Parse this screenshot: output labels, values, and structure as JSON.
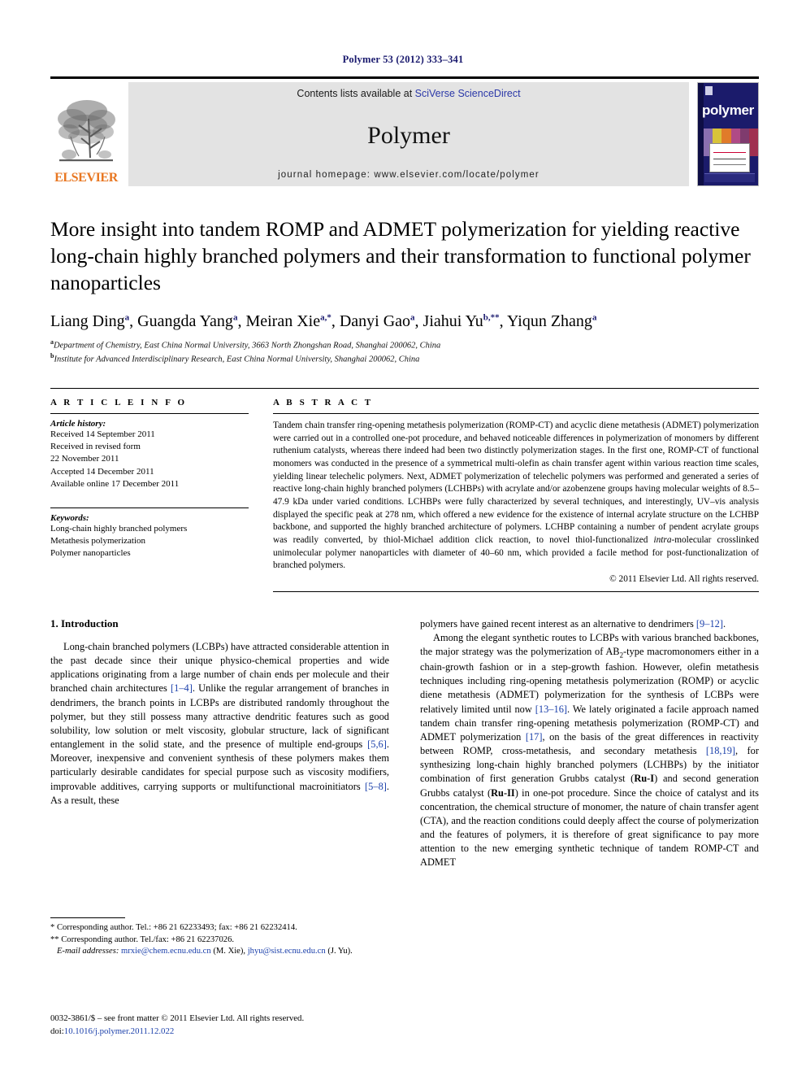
{
  "running_head": "Polymer 53 (2012) 333–341",
  "masthead": {
    "publisher": "ELSEVIER",
    "contents_prefix": "Contents lists available at ",
    "contents_link": "SciVerse ScienceDirect",
    "journal_title": "Polymer",
    "homepage": "journal homepage: www.elsevier.com/locate/polymer",
    "cover_word": "polymer"
  },
  "article": {
    "title": "More insight into tandem ROMP and ADMET polymerization for yielding reactive long-chain highly branched polymers and their transformation to functional polymer nanoparticles",
    "authors": [
      {
        "name": "Liang Ding",
        "sup": "a",
        "sep": ", "
      },
      {
        "name": "Guangda Yang",
        "sup": "a",
        "sep": ", "
      },
      {
        "name": "Meiran Xie",
        "sup": "a,*",
        "sep": ", "
      },
      {
        "name": "Danyi Gao",
        "sup": "a",
        "sep": ", "
      },
      {
        "name": "Jiahui Yu",
        "sup": "b,**",
        "sep": ", "
      },
      {
        "name": "Yiqun Zhang",
        "sup": "a",
        "sep": ""
      }
    ],
    "affiliations": [
      {
        "sup": "a",
        "text": "Department of Chemistry, East China Normal University, 3663 North Zhongshan Road, Shanghai 200062, China"
      },
      {
        "sup": "b",
        "text": "Institute for Advanced Interdisciplinary Research, East China Normal University, Shanghai 200062, China"
      }
    ]
  },
  "info": {
    "label": "A R T I C L E   I N F O",
    "history_heading": "Article history:",
    "history": [
      "Received 14 September 2011",
      "Received in revised form",
      "22 November 2011",
      "Accepted 14 December 2011",
      "Available online 17 December 2011"
    ],
    "keywords_heading": "Keywords:",
    "keywords": [
      "Long-chain highly branched polymers",
      "Metathesis polymerization",
      "Polymer nanoparticles"
    ]
  },
  "abstract": {
    "label": "A B S T R A C T",
    "part1": "Tandem chain transfer ring-opening metathesis polymerization (ROMP-CT) and acyclic diene metathesis (ADMET) polymerization were carried out in a controlled one-pot procedure, and behaved noticeable differences in polymerization of monomers by different ruthenium catalysts, whereas there indeed had been two distinctly polymerization stages. In the first one, ROMP-CT of functional monomers was conducted in the presence of a symmetrical multi-olefin as chain transfer agent within various reaction time scales, yielding linear telechelic polymers. Next, ADMET polymerization of telechelic polymers was performed and generated a series of reactive long-chain highly branched polymers (LCHBPs) with acrylate and/or azobenzene groups having molecular weights of 8.5–47.9 kDa under varied conditions. LCHBPs were fully characterized by several techniques, and interestingly, UV–vis analysis displayed the specific peak at 278 nm, which offered a new evidence for the existence of internal acrylate structure on the LCHBP backbone, and supported the highly branched architecture of polymers. LCHBP containing a number of pendent acrylate groups was readily converted, by thiol-Michael addition click reaction, to novel thiol-functionalized ",
    "italic": "intra",
    "part2": "-molecular crosslinked unimolecular polymer nanoparticles with diameter of 40–60 nm, which provided a facile method for post-functionalization of branched polymers.",
    "copyright": "© 2011 Elsevier Ltd. All rights reserved."
  },
  "section": {
    "number_title": "1. Introduction"
  },
  "body": {
    "left_p1_a": "Long-chain branched polymers (LCBPs) have attracted considerable attention in the past decade since their unique physico-chemical properties and wide applications originating from a large number of chain ends per molecule and their branched chain architectures ",
    "left_ref1": "[1–4]",
    "left_p1_b": ". Unlike the regular arrangement of branches in dendrimers, the branch points in LCBPs are distributed randomly throughout the polymer, but they still possess many attractive dendritic features such as good solubility, low solution or melt viscosity, globular structure, lack of significant entanglement in the solid state, and the presence of multiple end-groups ",
    "left_ref2": "[5,6]",
    "left_p1_c": ". Moreover, inexpensive and convenient synthesis of these polymers makes them particularly desirable candidates for special purpose such as viscosity modifiers, improvable additives, carrying supports or multifunctional macroinitiators ",
    "left_ref3": "[5–8]",
    "left_p1_d": ". As a result, these",
    "right_p1_a": "polymers have gained recent interest as an alternative to dendrimers ",
    "right_ref1": "[9–12]",
    "right_p1_b": ".",
    "right_p2_a": "Among the elegant synthetic routes to LCBPs with various branched backbones, the major strategy was the polymerization of AB",
    "right_sub1": "2",
    "right_p2_b": "-type macromonomers either in a chain-growth fashion or in a step-growth fashion. However, olefin metathesis techniques including ring-opening metathesis polymerization (ROMP) or acyclic diene metathesis (ADMET) polymerization for the synthesis of LCBPs were relatively limited until now ",
    "right_ref2": "[13–16]",
    "right_p2_c": ". We lately originated a facile approach named tandem chain transfer ring-opening metathesis polymerization (ROMP-CT) and ADMET polymerization ",
    "right_ref3": "[17]",
    "right_p2_d": ", on the basis of the great differences in reactivity between ROMP, cross-metathesis, and secondary metathesis ",
    "right_ref4": "[18,19]",
    "right_p2_e": ", for synthesizing long-chain highly branched polymers (LCHBPs) by the initiator combination of first generation Grubbs catalyst (",
    "right_bold1": "Ru-I",
    "right_p2_f": ") and second generation Grubbs catalyst (",
    "right_bold2": "Ru-II",
    "right_p2_g": ") in one-pot procedure. Since the choice of catalyst and its concentration, the chemical structure of monomer, the nature of chain transfer agent (CTA), and the reaction conditions could deeply affect the course of polymerization and the features of polymers, it is therefore of great significance to pay more attention to the new emerging synthetic technique of tandem ROMP-CT and ADMET"
  },
  "footnotes": {
    "corr1": "* Corresponding author. Tel.: +86 21 62233493; fax: +86 21 62232414.",
    "corr2": "** Corresponding author. Tel./fax: +86 21 62237026.",
    "email_label": "E-mail addresses:",
    "email1": "mrxie@chem.ecnu.edu.cn",
    "email1_owner": "(M. Xie),",
    "email2": "jhyu@sist.ecnu.edu.cn",
    "email2_owner": "(J. Yu)."
  },
  "imprint": {
    "line1": "0032-3861/$ – see front matter © 2011 Elsevier Ltd. All rights reserved.",
    "doi_label": "doi:",
    "doi_value": "10.1016/j.polymer.2011.12.022"
  },
  "colors": {
    "link_blue": "#1a3faa",
    "runhead_navy": "#1a1a6e",
    "elsevier_orange": "#E87722",
    "banner_gray": "#e3e3e3",
    "cover_navy": "#1b1b6b"
  }
}
